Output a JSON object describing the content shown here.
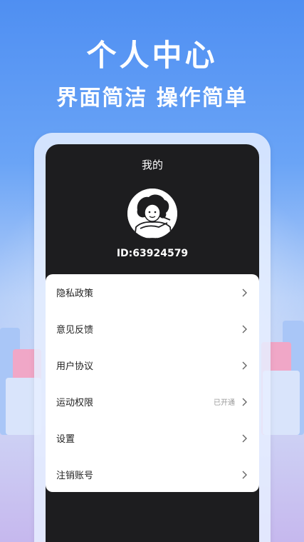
{
  "promo": {
    "headline": "个人中心",
    "subheadline": "界面简洁 操作简单"
  },
  "screen": {
    "title": "我的",
    "user_id": "ID:63924579"
  },
  "menu": [
    {
      "label": "隐私政策",
      "extra": "",
      "icon": "chevron-right-icon"
    },
    {
      "label": "意见反馈",
      "extra": "",
      "icon": "chevron-right-icon"
    },
    {
      "label": "用户协议",
      "extra": "",
      "icon": "chevron-right-icon"
    },
    {
      "label": "运动权限",
      "extra": "已开通",
      "icon": "chevron-right-icon"
    },
    {
      "label": "设置",
      "extra": "",
      "icon": "chevron-right-icon"
    },
    {
      "label": "注销账号",
      "extra": "",
      "icon": "chevron-right-icon"
    }
  ],
  "colors": {
    "screen_background": "#1d1d1f",
    "menu_background": "#ffffff",
    "background_top": "#4f8ff2",
    "background_bottom": "#c6b8ee"
  }
}
